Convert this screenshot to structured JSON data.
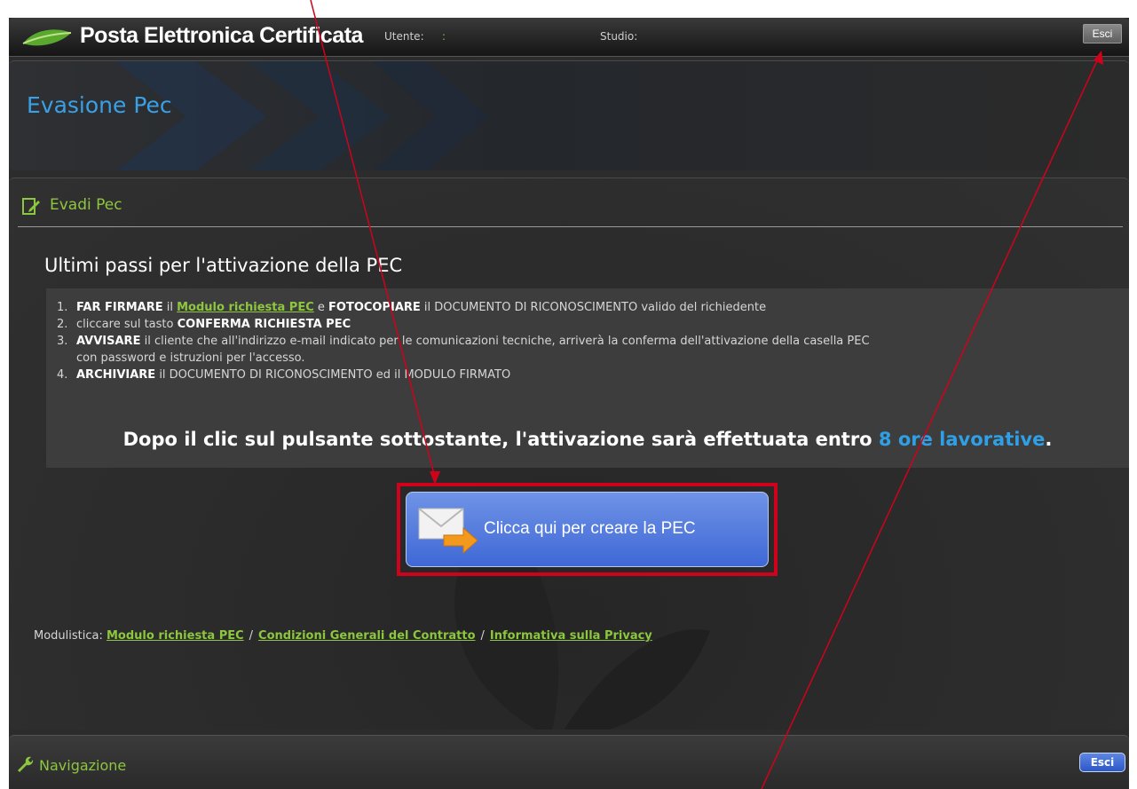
{
  "topbar": {
    "brand": "Posta Elettronica Certificata",
    "user_label": "Utente:",
    "user_value": ":",
    "studio_label": "Studio:",
    "exit_label": "Esci"
  },
  "header": {
    "title": "Evasione Pec"
  },
  "section": {
    "title": "Evadi Pec"
  },
  "steps": {
    "heading": "Ultimi passi per l'attivazione della PEC",
    "items": [
      {
        "num": "1.",
        "b1": "FAR FIRMARE",
        "t1": " il ",
        "link": "Modulo richiesta PEC",
        "t2": " e ",
        "b2": "FOTOCOPIARE",
        "t3": " il DOCUMENTO DI RICONOSCIMENTO valido del richiedente"
      },
      {
        "num": "2.",
        "t1": "cliccare sul tasto ",
        "b1": "CONFERMA RICHIESTA PEC"
      },
      {
        "num": "3.",
        "b1": "AVVISARE",
        "t1": " il cliente che all'indirizzo e-mail indicato per le comunicazioni tecniche, arriverà la conferma dell'attivazione della casella PEC",
        "cont": "con password e istruzioni per l'accesso."
      },
      {
        "num": "4.",
        "b1": "ARCHIVIARE",
        "t1": " il DOCUMENTO DI RICONOSCIMENTO ed il MODULO FIRMATO"
      }
    ],
    "notice_pre": "Dopo il clic sul pulsante sottostante, l'attivazione sarà effettuata entro ",
    "notice_highlight": "8 ore lavorative",
    "notice_post": "."
  },
  "create_button": {
    "label": "Clicca qui per creare la PEC",
    "icon": "mail-arrow-icon"
  },
  "forms": {
    "label": "Modulistica: ",
    "links": [
      "Modulo richiesta PEC",
      "Condizioni Generali del Contratto",
      "Informativa sulla Privacy"
    ],
    "separator": "/"
  },
  "navbar": {
    "title": "Navigazione",
    "exit_label": "Esci"
  },
  "colors": {
    "accent_green": "#8dc63f",
    "accent_blue": "#2f9fe6",
    "annotation_red": "#d0021b"
  }
}
